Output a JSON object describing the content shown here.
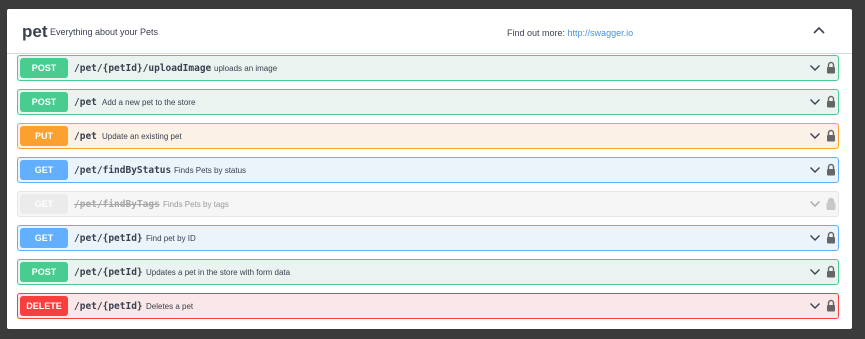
{
  "tag": {
    "name": "pet",
    "description": "Everything about your Pets",
    "find_out_more_label": "Find out more:",
    "find_out_more_link": "http://swagger.io"
  },
  "colors": {
    "post": "#49cc90",
    "put": "#fca130",
    "get": "#61affe",
    "delete": "#f93e3e",
    "deprecated": "#ebebeb"
  },
  "operations": [
    {
      "method": "POST",
      "path": "/pet/{petId}/uploadImage",
      "summary": "uploads an image"
    },
    {
      "method": "POST",
      "path": "/pet",
      "summary": "Add a new pet to the store"
    },
    {
      "method": "PUT",
      "path": "/pet",
      "summary": "Update an existing pet"
    },
    {
      "method": "GET",
      "path": "/pet/findByStatus",
      "summary": "Finds Pets by status"
    },
    {
      "method": "GET",
      "path": "/pet/findByTags",
      "summary": "Finds Pets by tags",
      "deprecated": true
    },
    {
      "method": "GET",
      "path": "/pet/{petId}",
      "summary": "Find pet by ID"
    },
    {
      "method": "POST",
      "path": "/pet/{petId}",
      "summary": "Updates a pet in the store with form data"
    },
    {
      "method": "DELETE",
      "path": "/pet/{petId}",
      "summary": "Deletes a pet"
    }
  ],
  "icons": {
    "collapse": "chevron-up-icon",
    "expand": "chevron-down-icon",
    "auth": "lock-icon"
  }
}
